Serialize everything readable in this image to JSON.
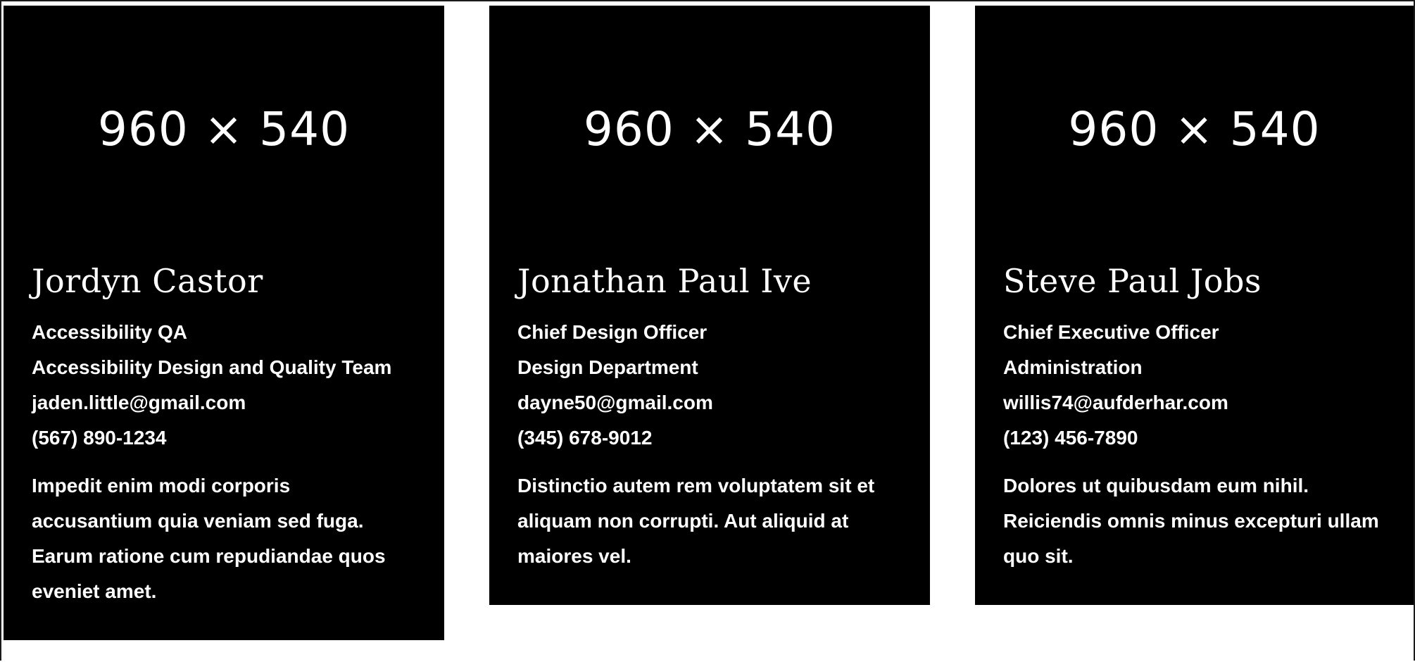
{
  "colors": {
    "card_background": "#000000",
    "card_text": "#ffffff",
    "page_background": "#ffffff"
  },
  "cards": [
    {
      "image_placeholder": "960 × 540",
      "name": "Jordyn Castor",
      "title": "Accessibility QA",
      "department": "Accessibility Design and Quality Team",
      "email": "jaden.little@gmail.com",
      "phone": "(567) 890-1234",
      "bio": "Impedit enim modi corporis accusantium quia veniam sed fuga. Earum ratione cum repudiandae quos eveniet amet."
    },
    {
      "image_placeholder": "960 × 540",
      "name": "Jonathan Paul Ive",
      "title": "Chief Design Officer",
      "department": "Design Department",
      "email": "dayne50@gmail.com",
      "phone": "(345) 678-9012",
      "bio": "Distinctio autem rem voluptatem sit et aliquam non corrupti. Aut aliquid at maiores vel."
    },
    {
      "image_placeholder": "960 × 540",
      "name": "Steve Paul Jobs",
      "title": "Chief Executive Officer",
      "department": "Administration",
      "email": "willis74@aufderhar.com",
      "phone": "(123) 456-7890",
      "bio": "Dolores ut quibusdam eum nihil. Reiciendis omnis minus excepturi ullam quo sit."
    }
  ]
}
